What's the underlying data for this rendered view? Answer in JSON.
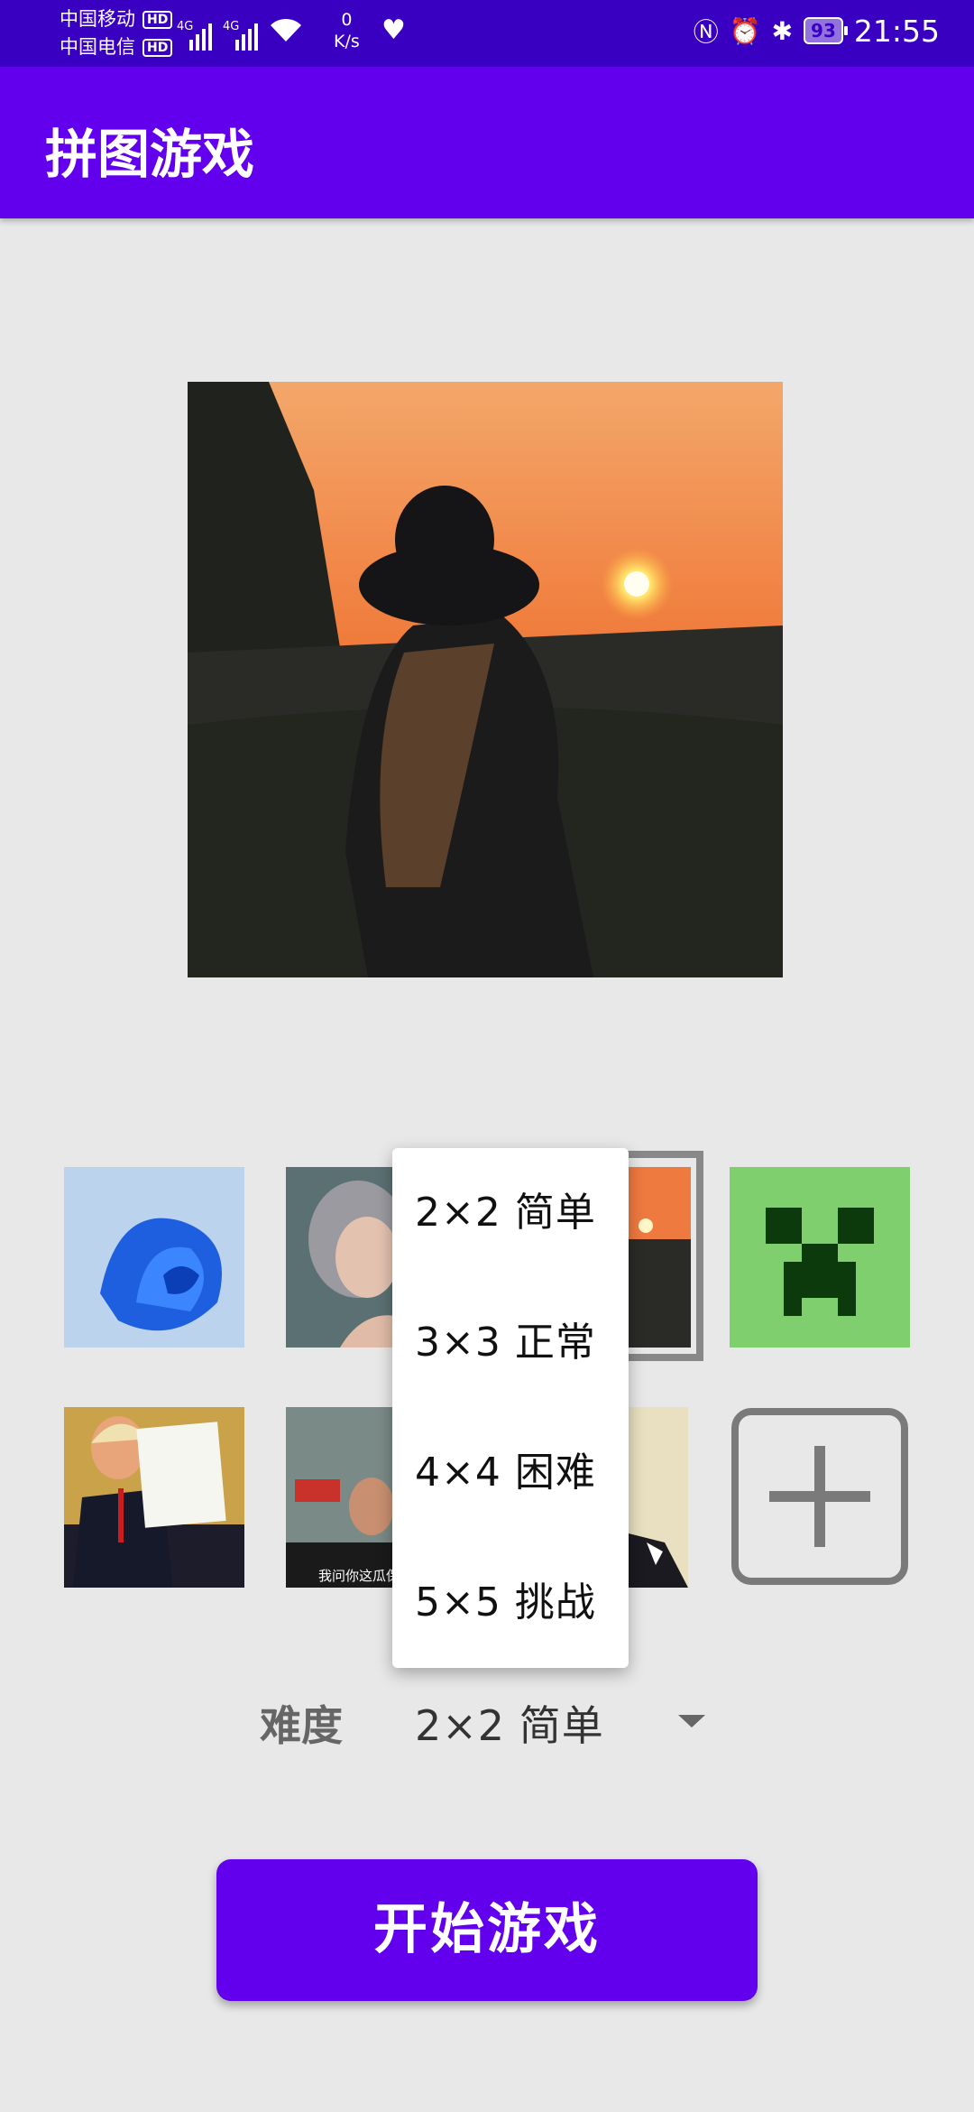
{
  "status_bar": {
    "carrier_1": "中国移动",
    "carrier_2": "中国电信",
    "hd_badge": "HD",
    "network_type": "4G",
    "net_speed_value": "0",
    "net_speed_unit": "K/s",
    "battery": "93",
    "time": "21:55",
    "icons": [
      "signal-icon",
      "wifi-icon",
      "heart-health-icon",
      "nfc-icon",
      "alarm-icon",
      "bluetooth-icon",
      "battery-icon"
    ]
  },
  "app_bar": {
    "title": "拼图游戏"
  },
  "gallery": {
    "items": [
      {
        "name": "blue-flower-thumb"
      },
      {
        "name": "gray-hair-girl-thumb"
      },
      {
        "name": "sunset-girl-thumb",
        "selected": true
      },
      {
        "name": "creeper-face-thumb"
      },
      {
        "name": "president-signing-thumb"
      },
      {
        "name": "news-screenshot-thumb",
        "caption": "我问你这瓜保"
      },
      {
        "name": "man-in-suit-thumb"
      }
    ],
    "add_button_icon": "plus-icon"
  },
  "difficulty": {
    "label": "难度",
    "selected": "2×2  简单",
    "options": [
      "2×2  简单",
      "3×3  正常",
      "4×4  困难",
      "5×5  挑战"
    ]
  },
  "start_button": {
    "label": "开始游戏"
  },
  "colors": {
    "status_bar": "#3a00c2",
    "primary": "#6200ee",
    "background": "#e8e8e8"
  }
}
